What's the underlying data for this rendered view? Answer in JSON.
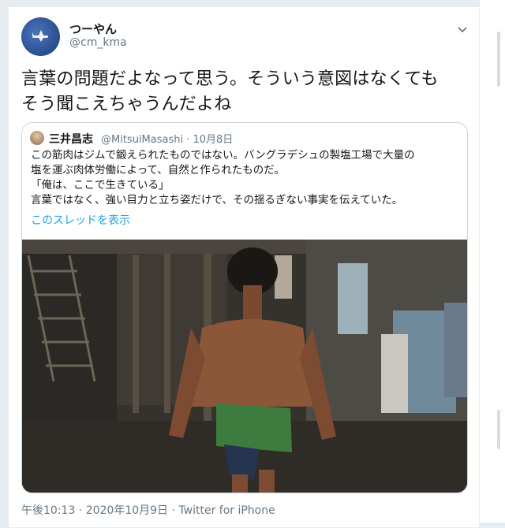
{
  "tweet": {
    "display_name": "つーやん",
    "handle": "@cm_kma",
    "text_lines": [
      "言葉の問題だよなって思う。そういう意図はなくても",
      "そう聞こえちゃうんだよね"
    ],
    "timestamp": "午後10:13 · 2020年10月9日 · Twitter for iPhone"
  },
  "quoted": {
    "display_name": "三井昌志",
    "meta": "@MitsuiMasashi · 10月8日",
    "body_lines": [
      "この筋肉はジムで鍛えられたものではない。バングラデシュの製塩工場で大量の",
      "塩を運ぶ肉体労働によって、自然と作られたものだ。",
      "「俺は、ここで生きている」",
      "言葉ではなく、強い目力と立ち姿だけで、その揺るぎない事実を伝えていた。"
    ],
    "thread_link": "このスレッドを表示"
  },
  "icons": {
    "caret": "chevron-down-icon",
    "avatar": "airplane-avatar"
  },
  "colors": {
    "link": "#1da1f2",
    "secondary_text": "#657786",
    "border": "#ccd6dd"
  }
}
